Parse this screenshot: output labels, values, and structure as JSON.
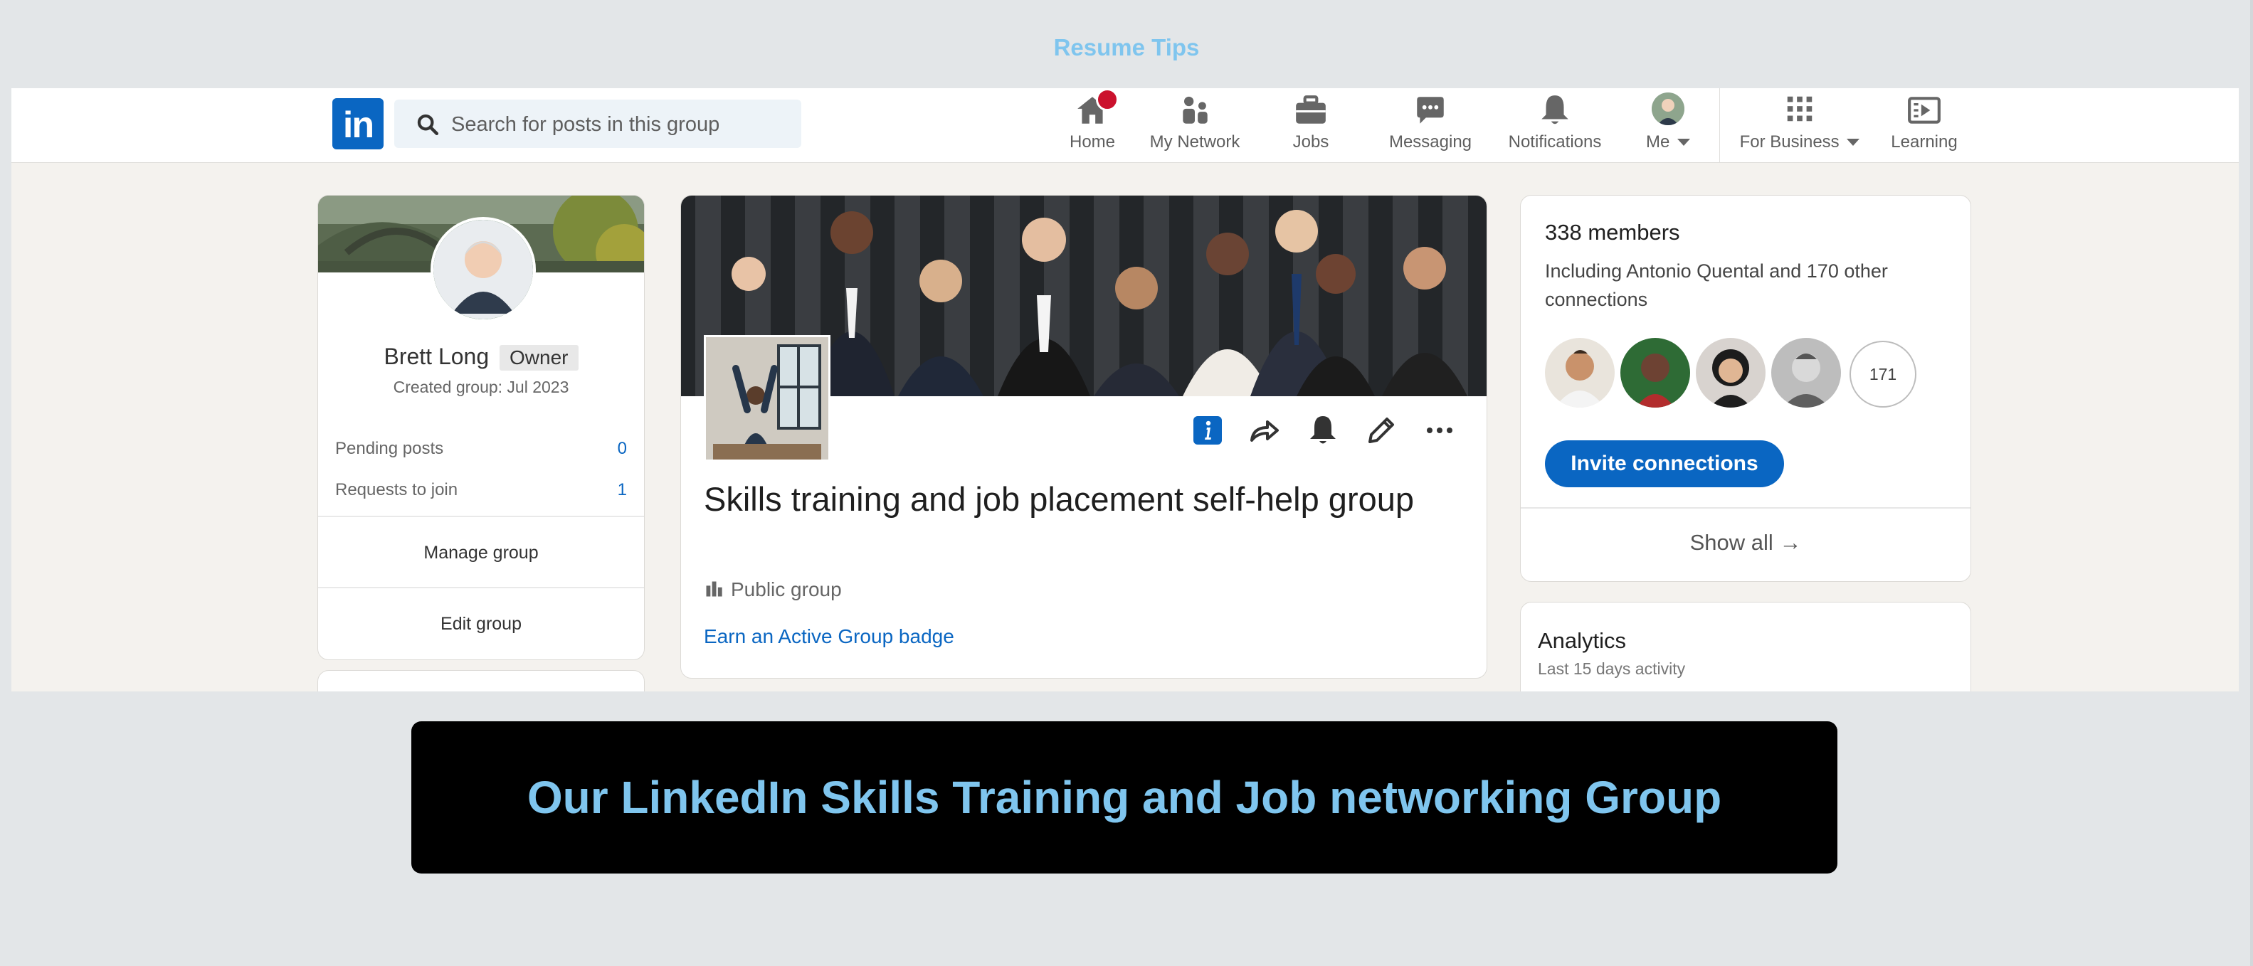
{
  "page": {
    "heading": "Resume Tips"
  },
  "navbar": {
    "logo_text": "in",
    "search_placeholder": "Search for posts in this group",
    "items": [
      {
        "label": "Home",
        "icon": "home-icon"
      },
      {
        "label": "My Network",
        "icon": "network-icon"
      },
      {
        "label": "Jobs",
        "icon": "briefcase-icon"
      },
      {
        "label": "Messaging",
        "icon": "messaging-icon"
      },
      {
        "label": "Notifications",
        "icon": "bell-icon"
      },
      {
        "label": "Me",
        "icon": "avatar"
      },
      {
        "label": "For Business",
        "icon": "grid-icon"
      },
      {
        "label": "Learning",
        "icon": "learning-icon"
      }
    ],
    "home_badge_color": "#cb112d",
    "brand_color": "#0a66c2"
  },
  "left_panel": {
    "name": "Brett Long",
    "role": "Owner",
    "created": "Created group: Jul 2023",
    "stats": [
      {
        "label": "Pending posts",
        "value": "0"
      },
      {
        "label": "Requests to join",
        "value": "1"
      }
    ],
    "manage_label": "Manage group",
    "edit_label": "Edit group"
  },
  "group": {
    "title": "Skills training and job placement self-help group",
    "visibility": "Public group",
    "badge_link": "Earn an Active Group badge",
    "actions": [
      "info-icon",
      "share-icon",
      "bell-icon",
      "edit-icon",
      "more-icon"
    ]
  },
  "members_panel": {
    "count": "338 members",
    "including": "Including Antonio Quental and 170 other connections",
    "more_count": "171",
    "invite_label": "Invite connections",
    "show_all": "Show all →"
  },
  "analytics": {
    "title": "Analytics",
    "subtitle": "Last 15 days activity"
  },
  "banner": {
    "text": "Our LinkedIn Skills Training and Job networking Group"
  }
}
